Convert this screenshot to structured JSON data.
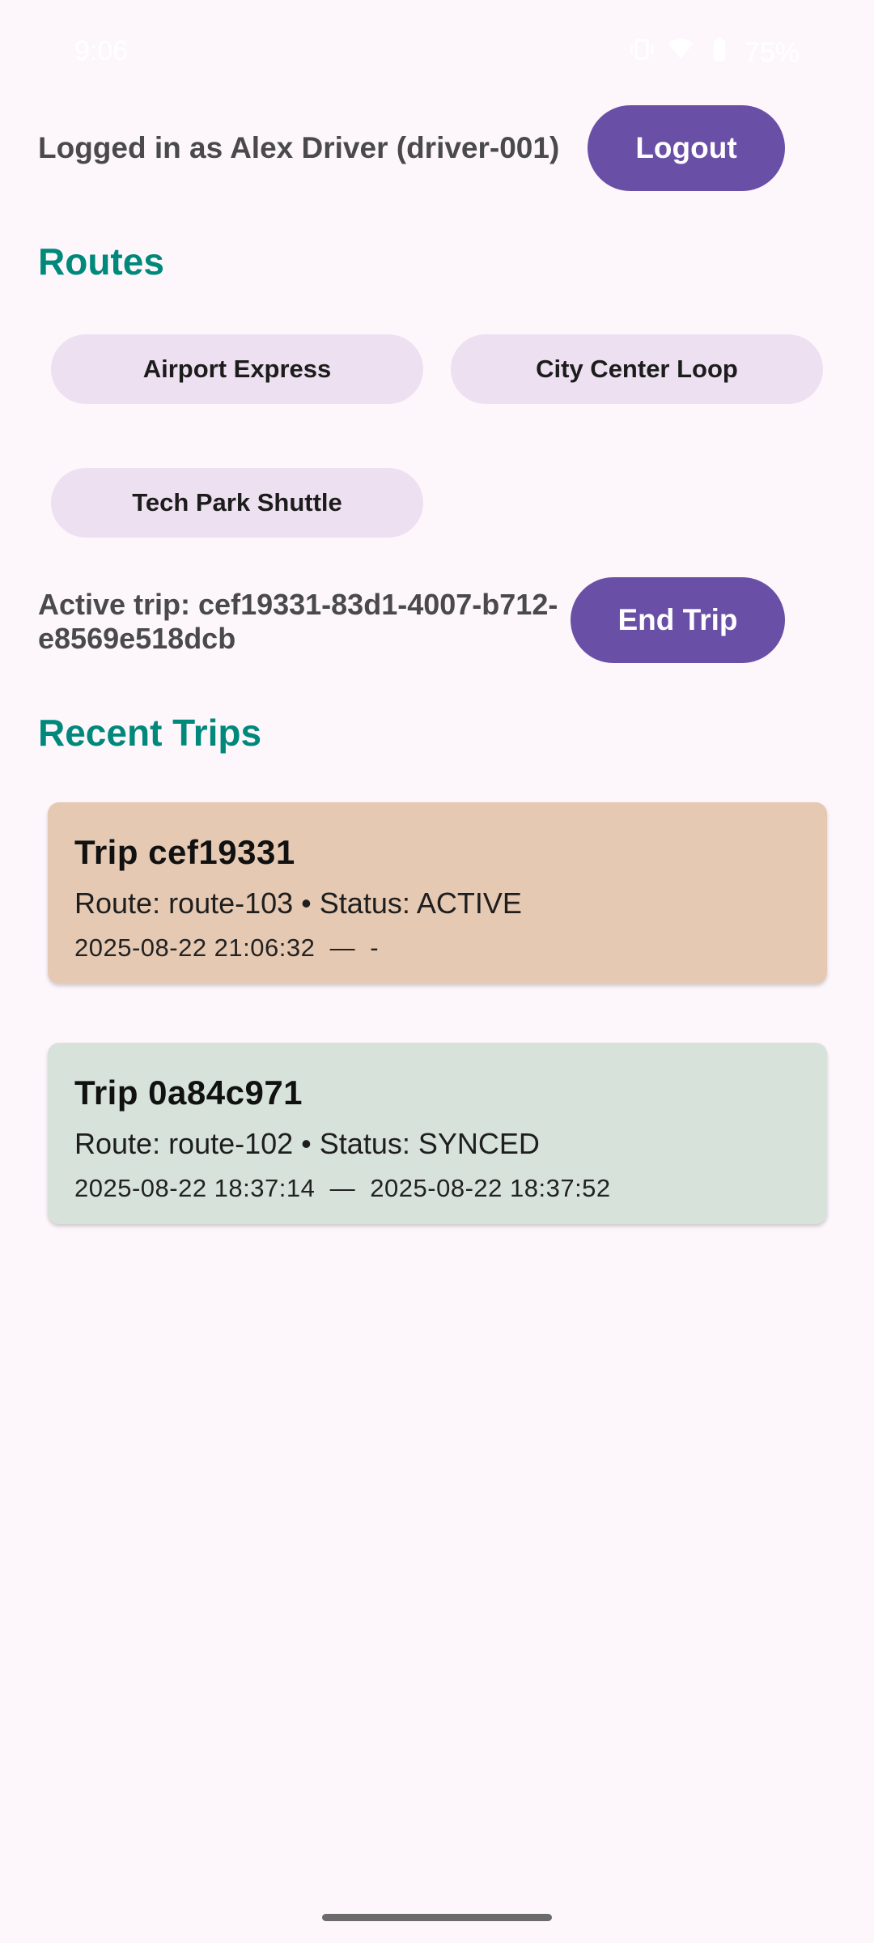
{
  "status_bar": {
    "time": "9:06",
    "battery": "75%",
    "icons": [
      "vibrate-icon",
      "wifi-icon",
      "battery-icon"
    ]
  },
  "header": {
    "login_text": "Logged in as Alex Driver (driver-001)",
    "logout_label": "Logout"
  },
  "routes": {
    "title": "Routes",
    "items": [
      {
        "label": "Airport Express"
      },
      {
        "label": "City Center Loop"
      },
      {
        "label": "Tech Park Shuttle"
      }
    ]
  },
  "active_trip": {
    "text": "Active trip: cef19331-83d1-4007-b712-e8569e518dcb",
    "end_label": "End Trip"
  },
  "recent_trips": {
    "title": "Recent Trips",
    "items": [
      {
        "title": "Trip cef19331",
        "route_status": "Route: route-103 • Status: ACTIVE",
        "times": "2025-08-22 21:06:32  —  -"
      },
      {
        "title": "Trip 0a84c971",
        "route_status": "Route: route-102 • Status: SYNCED",
        "times": "2025-08-22 18:37:14  —  2025-08-22 18:37:52"
      }
    ]
  },
  "colors": {
    "background": "#fdf7fc",
    "primary_button": "#6a4fa6",
    "section_title": "#00897b",
    "chip": "#ede0f0",
    "card_active": "#e6c9b2",
    "card_synced": "#d7e2da"
  }
}
